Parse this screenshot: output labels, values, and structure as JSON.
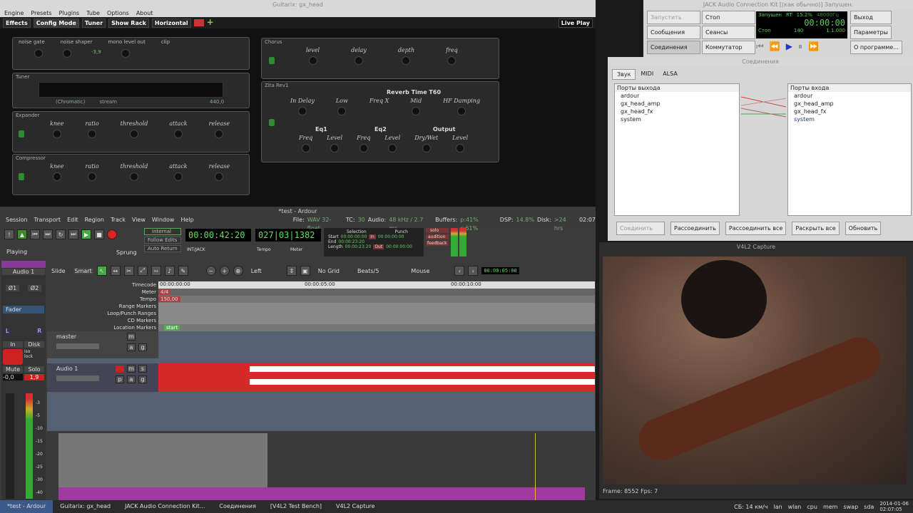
{
  "guitarix": {
    "title": "Guitarix: gx_head",
    "menu": [
      "Engine",
      "Presets",
      "Plugins",
      "Tube",
      "Options",
      "About"
    ],
    "toolbar": [
      "Effects",
      "Config Mode",
      "Tuner",
      "Show Rack",
      "Horizontal"
    ],
    "live_play": "Live Play",
    "top_strip": [
      "noise gate",
      "noise shaper",
      "mono level out",
      "clip"
    ],
    "mono_level": "-3,9",
    "tuner": {
      "title": "Tuner",
      "mode": "(Chromatic)",
      "stream": "stream",
      "freq": "440,0"
    },
    "expander": {
      "title": "Expander",
      "knobs": [
        "knee",
        "ratio",
        "threshold",
        "attack",
        "release"
      ]
    },
    "compressor": {
      "title": "Compressor",
      "knobs": [
        "knee",
        "ratio",
        "threshold",
        "attack",
        "release"
      ]
    },
    "chorus": {
      "title": "Chorus",
      "knobs": [
        "level",
        "delay",
        "depth",
        "freq"
      ]
    },
    "zita": {
      "title": "Zita Rev1",
      "reverb": "Reverb Time T60",
      "in_delay": "In Delay",
      "low": "Low",
      "freqx": "Freq X",
      "mid": "Mid",
      "hf": "HF Damping",
      "eq1": "Eq1",
      "eq2": "Eq2",
      "output": "Output",
      "freq": "Freq",
      "level": "Level",
      "drywet": "Dry/Wet"
    }
  },
  "ardour": {
    "title": "*test - Ardour",
    "menu": [
      "Session",
      "Transport",
      "Edit",
      "Region",
      "Track",
      "View",
      "Window",
      "Help"
    ],
    "status": {
      "file": "File:",
      "file_val": "WAV 32-float",
      "tc": "TC:",
      "tc_val": "30",
      "audio": "Audio:",
      "audio_val": "48 kHz / 2.7 ms",
      "buffers": "Buffers:",
      "buffers_val": "p:41% c:61%",
      "dsp": "DSP:",
      "dsp_val": "14.8%",
      "disk": "Disk:",
      "disk_val": ">24 hrs",
      "time": "02:07"
    },
    "internal": "Internal",
    "follow": "Follow Edits",
    "autoreturn": "Auto Return",
    "clock1": "00:00:42:20",
    "clock2": "027|03|1382",
    "intjack": "INT/JACK",
    "tempo": "Tempo",
    "meter": "Meter",
    "selection": "Selection",
    "punch": "Punch",
    "start": "Start",
    "end": "End",
    "length": "Length",
    "sel_time": "00:00:23:20",
    "zero_time": "00:00:00:00",
    "in": "In",
    "out": "Out",
    "solo": "solo",
    "audition": "audition",
    "feedback": "feedback",
    "playing": "Playing",
    "sprung": "Sprung",
    "edit": {
      "slide": "Slide",
      "smart": "Smart",
      "left": "Left",
      "nogrid": "No Grid",
      "beats": "Beats/5",
      "mouse": "Mouse",
      "nudge": "00:00:05:00"
    },
    "rulers": [
      "Timecode",
      "Meter",
      "Tempo",
      "Range Markers",
      "Loop/Punch Ranges",
      "CD Markers",
      "Location Markers"
    ],
    "ticks": [
      "00:00:00:00",
      "00:00:05:00",
      "00:00:10:00"
    ],
    "meter_val": "4/4",
    "tempo_val": "150,00",
    "start_marker": "start",
    "tracks": [
      {
        "name": "master"
      },
      {
        "name": "Audio 1"
      }
    ],
    "strip": {
      "name": "Audio 1",
      "in": "In",
      "disk": "Disk",
      "iso": "iso",
      "lock": "lock",
      "mute": "Mute",
      "solo": "Solo",
      "gain": "-0,0",
      "peak": "1,9",
      "fader": "Fader",
      "phase1": "Ø1",
      "phase2": "Ø2",
      "L": "L",
      "R": "R"
    },
    "scale": [
      "-3",
      "-5",
      "-10",
      "-15",
      "-20",
      "-25",
      "-30",
      "-40"
    ]
  },
  "jack": {
    "title": "JACK Audio Connection Kit [(как обычно)] Запущен.",
    "start": "Запустить",
    "stop": "Стоп",
    "messages": "Сообщения",
    "sessions": "Сеансы",
    "connect": "Соединения",
    "patchbay": "Коммутатор",
    "exit": "Выход",
    "setup": "Параметры",
    "about": "О программе...",
    "status": "Запущен",
    "rt": "RT",
    "dsp": "15.2%",
    "rate": "48000Гц",
    "time": "00:00:00",
    "stop_lbl": "Стоп",
    "bpm": "140",
    "bbt": "1.1.000"
  },
  "connections": {
    "title": "Соединения",
    "tabs": [
      "Звук",
      "MIDI",
      "ALSA"
    ],
    "out_header": "Порты выхода",
    "in_header": "Порты входа",
    "out_ports": [
      "ardour",
      "gx_head_amp",
      "gx_head_fx",
      "system"
    ],
    "in_ports": [
      "ardour",
      "gx_head_amp",
      "gx_head_fx",
      "system"
    ],
    "buttons": [
      "Соединить",
      "Рассоединить",
      "Рассоединить все",
      "Раскрыть все",
      "Обновить"
    ]
  },
  "v4l2": {
    "title": "V4L2 Capture",
    "frame": "Frame: 8552 Fps: 7"
  },
  "taskbar": {
    "tasks": [
      "*test - Ardour",
      "Guitarix: gx_head",
      "JACK Audio Connection Kit...",
      "Соединения",
      "[V4L2 Test Bench]",
      "V4L2 Capture"
    ],
    "weather": "СБ: 14 км/ч",
    "items": [
      "lan",
      "wlan",
      "cpu",
      "mem",
      "swap",
      "sda"
    ],
    "date": "2014-01-06",
    "time": "02:07:05"
  }
}
